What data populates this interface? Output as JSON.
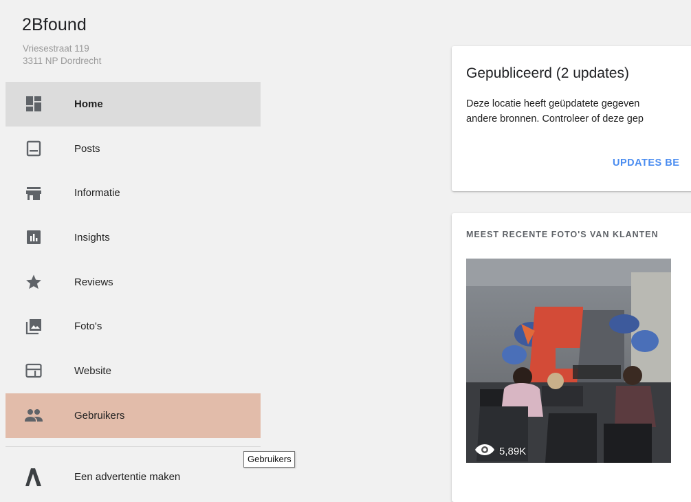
{
  "business": {
    "name": "2Bfound",
    "address_line1": "Vriesestraat 119",
    "address_line2": "3311 NP Dordrecht"
  },
  "nav": {
    "items": [
      {
        "label": "Home",
        "icon": "dashboard-icon",
        "state": "active"
      },
      {
        "label": "Posts",
        "icon": "posts-icon"
      },
      {
        "label": "Informatie",
        "icon": "storefront-icon"
      },
      {
        "label": "Insights",
        "icon": "insights-icon"
      },
      {
        "label": "Reviews",
        "icon": "star-icon"
      },
      {
        "label": "Foto's",
        "icon": "photos-icon"
      },
      {
        "label": "Website",
        "icon": "website-icon"
      },
      {
        "label": "Gebruikers",
        "icon": "users-icon",
        "state": "hover"
      }
    ],
    "ad_label": "Een advertentie maken"
  },
  "tooltip": {
    "text": "Gebruikers"
  },
  "published_card": {
    "title": "Gepubliceerd (2 updates)",
    "desc_line1": "Deze locatie heeft geüpdatete gegeven",
    "desc_line2": "andere bronnen. Controleer of deze gep",
    "updates_button": "UPDATES BE"
  },
  "photos_card": {
    "heading": "MEEST RECENTE FOTO'S VAN KLANTEN",
    "photo_views": "5,89K"
  },
  "colors": {
    "active_bg": "#dcdcdc",
    "hover_bg": "#e2bcaa",
    "link_blue": "#4a8cf0",
    "icon_gray": "#5f6368"
  }
}
